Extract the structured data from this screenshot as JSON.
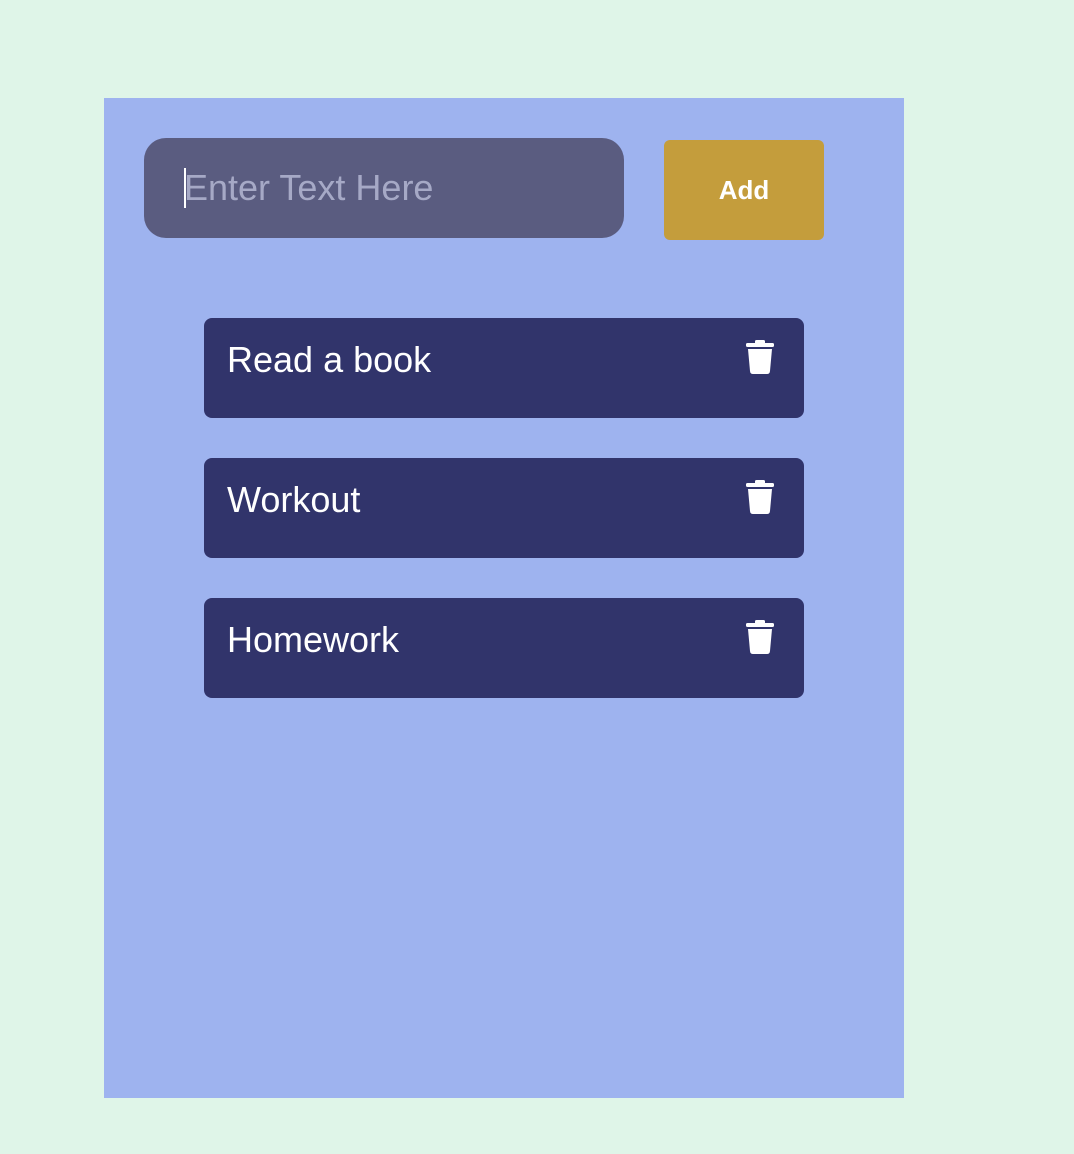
{
  "composer": {
    "placeholder": "Enter Text Here",
    "value": "",
    "add_label": "Add"
  },
  "todos": [
    {
      "label": "Read a book",
      "action_icon": "trash-icon"
    },
    {
      "label": "Workout",
      "action_icon": "trash-icon"
    },
    {
      "label": "Homework",
      "action_icon": "trash-icon"
    }
  ],
  "colors": {
    "page_background": "#dff5e8",
    "panel_background": "#9eb3ef",
    "input_background": "#5a5c80",
    "placeholder_text": "#a6a9c6",
    "add_button": "#c49d3c",
    "todo_item_background": "#31346b",
    "item_text": "#ffffff"
  }
}
